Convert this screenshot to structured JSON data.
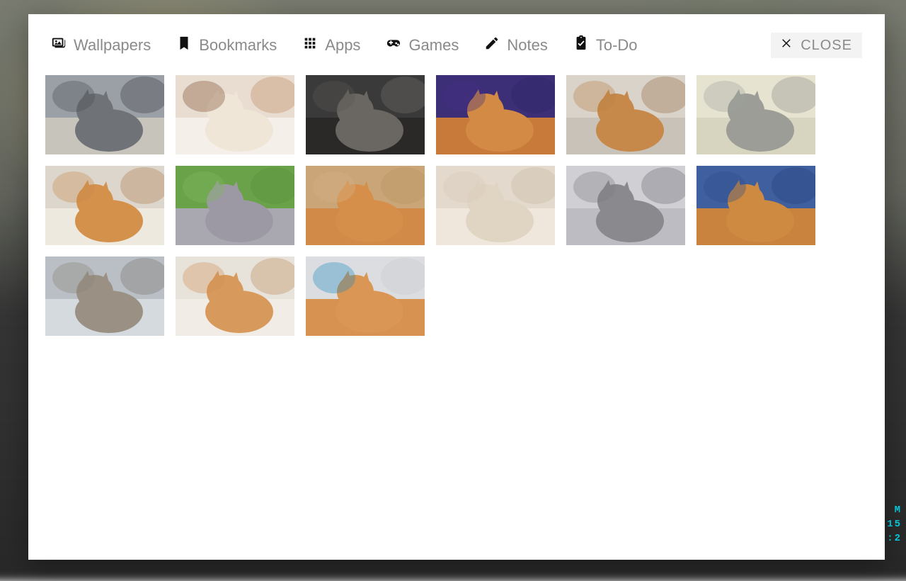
{
  "tabs": {
    "wallpapers": "Wallpapers",
    "bookmarks": "Bookmarks",
    "apps": "Apps",
    "games": "Games",
    "notes": "Notes",
    "todo": "To-Do"
  },
  "close_label": "CLOSE",
  "clock_fragments": [
    "M",
    "15",
    ":2"
  ],
  "wallpapers": [
    {
      "name": "cat-grey-street",
      "palette": [
        "#9aa0a6",
        "#4b4e52",
        "#c7c4bc",
        "#2f3033"
      ],
      "subject": "#6f7378"
    },
    {
      "name": "cat-orange-white",
      "palette": [
        "#e9ddd2",
        "#7c4a2a",
        "#f4efe9",
        "#b97c4a"
      ],
      "subject": "#f0e6d8"
    },
    {
      "name": "cat-dark-grey-face",
      "palette": [
        "#3b3a3a",
        "#5a5856",
        "#2a2928",
        "#7d7a76"
      ],
      "subject": "#6a6661"
    },
    {
      "name": "cat-orange-purple-bg",
      "palette": [
        "#3c2f78",
        "#432f84",
        "#c77a3a",
        "#2a2160"
      ],
      "subject": "#d28a44"
    },
    {
      "name": "cat-orange-leaning",
      "palette": [
        "#d9d3c9",
        "#b88145",
        "#c8c2b8",
        "#8b5e32"
      ],
      "subject": "#c6894a"
    },
    {
      "name": "cat-silver-lying",
      "palette": [
        "#e6e3d1",
        "#9fa09a",
        "#d7d4bf",
        "#7e7f7a"
      ],
      "subject": "#9c9d97"
    },
    {
      "name": "cat-orange-yawning",
      "palette": [
        "#dcd6cc",
        "#c98a4a",
        "#eee9df",
        "#a96e38"
      ],
      "subject": "#d3914c"
    },
    {
      "name": "cat-grey-grass",
      "palette": [
        "#6aa24a",
        "#7fb95c",
        "#a9a7b0",
        "#4f8a34"
      ],
      "subject": "#9c99a5"
    },
    {
      "name": "cat-orange-wood-bg",
      "palette": [
        "#c9a578",
        "#d6b286",
        "#d28a48",
        "#b78f5e"
      ],
      "subject": "#d58f4a"
    },
    {
      "name": "cat-cream-closeup",
      "palette": [
        "#e3d9cc",
        "#d7c9b7",
        "#efe7db",
        "#c3b39d"
      ],
      "subject": "#e0d4c3"
    },
    {
      "name": "cat-grey-blanket",
      "palette": [
        "#cfcfd4",
        "#7c7b80",
        "#bdbcc2",
        "#5f5e63"
      ],
      "subject": "#8a898e"
    },
    {
      "name": "cat-orange-blue-bg",
      "palette": [
        "#3f5f9e",
        "#2e4d8a",
        "#c9833f",
        "#1f3b73"
      ],
      "subject": "#cf8a42"
    },
    {
      "name": "cat-grey-orange-eyes",
      "palette": [
        "#b9bfc4",
        "#8a8377",
        "#d5dade",
        "#6d675c"
      ],
      "subject": "#9a9184"
    },
    {
      "name": "cat-held-towel",
      "palette": [
        "#e7e2da",
        "#d19055",
        "#f1ede6",
        "#b77a42"
      ],
      "subject": "#d79a5c"
    },
    {
      "name": "cat-orange-box",
      "palette": [
        "#dcdde0",
        "#1f8abf",
        "#d79150",
        "#c5c7ca"
      ],
      "subject": "#da9654"
    }
  ]
}
